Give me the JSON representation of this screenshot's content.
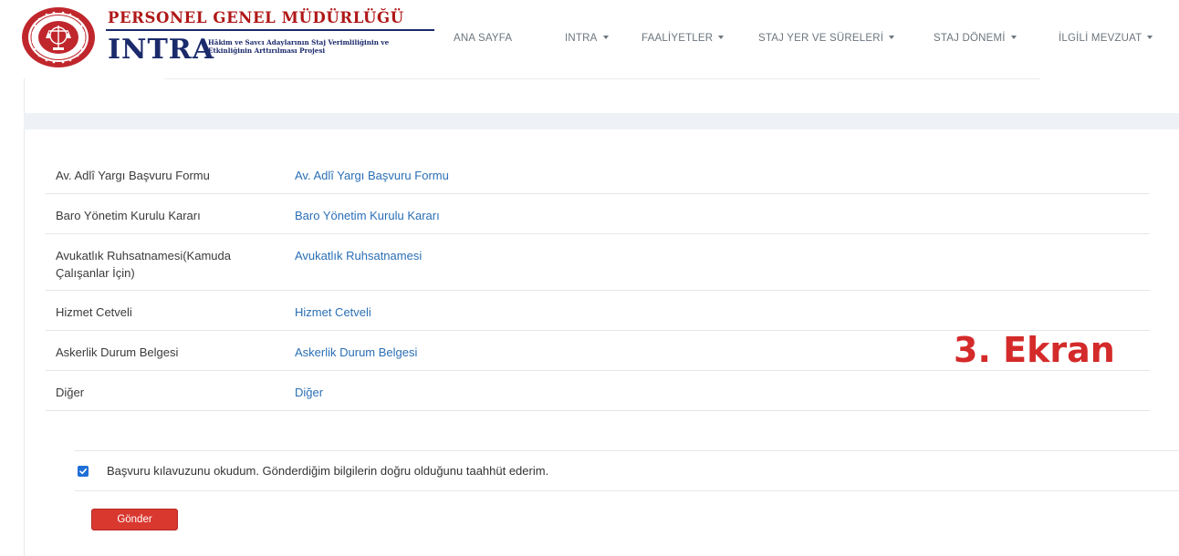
{
  "header": {
    "logo_title": "PERSONEL GENEL MÜDÜRLÜĞÜ",
    "logo_brand": "INTRA",
    "logo_subtitle_line1": "Hâkim ve Savcı Adaylarının Staj Verimliliğinin ve",
    "logo_subtitle_line2": "Etkinliğinin Arttırılması Projesi",
    "nav": [
      {
        "label": "ANA SAYFA",
        "dropdown": false
      },
      {
        "label": "INTRA",
        "dropdown": true
      },
      {
        "label": "FAALİYETLER",
        "dropdown": true
      },
      {
        "label": "STAJ YER VE SÜRELERİ",
        "dropdown": true
      },
      {
        "label": "STAJ DÖNEMİ",
        "dropdown": true
      },
      {
        "label": "İLGİLİ MEVZUAT",
        "dropdown": true
      }
    ]
  },
  "documents": [
    {
      "label": "Av. Adlî Yargı Başvuru Formu",
      "link": "Av. Adlî Yargı Başvuru Formu"
    },
    {
      "label": "Baro Yönetim Kurulu Kararı",
      "link": "Baro Yönetim Kurulu Kararı"
    },
    {
      "label_line1": "Avukatlık Ruhsatnamesi(Kamuda",
      "label_line2": "Çalışanlar İçin)",
      "link": "Avukatlık Ruhsatnamesi"
    },
    {
      "label": "Hizmet Cetveli",
      "link": "Hizmet Cetveli"
    },
    {
      "label": "Askerlik Durum Belgesi",
      "link": "Askerlik Durum Belgesi"
    },
    {
      "label": "Diğer",
      "link": "Diğer"
    }
  ],
  "consent": {
    "checked": true,
    "text": "Başvuru kılavuzunu okudum. Gönderdiğim bilgilerin doğru olduğunu taahhüt ederim."
  },
  "submit_label": "Gönder",
  "annotation": "3. Ekran",
  "colors": {
    "brand_red": "#b01818",
    "brand_navy": "#1b2a6b",
    "link": "#2a6fb5",
    "button": "#d9382f",
    "checkbox": "#1f6fd6",
    "annotation": "#d42a2a"
  }
}
